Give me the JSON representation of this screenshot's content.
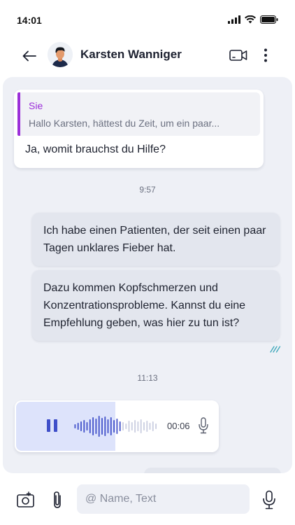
{
  "status_bar": {
    "time": "14:01",
    "icons": [
      "signal-icon",
      "wifi-icon",
      "battery-icon"
    ]
  },
  "header": {
    "contact_name": "Karsten Wanniger",
    "icons": [
      "back-arrow-icon",
      "avatar",
      "video-call-icon",
      "more-vertical-icon"
    ]
  },
  "chat": {
    "quoted_message": {
      "author": "Sie",
      "text": "Hallo Karsten, hättest du Zeit, um ein paar..."
    },
    "reply": "Ja, womit brauchst du Hilfe?",
    "time_1": "9:57",
    "outgoing": [
      "Ich habe einen Patienten, der seit einen paar Tagen unklares Fieber hat.",
      "Dazu kommen Kopfschmerzen und Konzentrationsprobleme. Kannst du eine Empfehlung geben, was hier zu tun ist?"
    ],
    "time_2": "11:13",
    "voice_message": {
      "duration": "00:06",
      "played_fraction": 0.5
    }
  },
  "input": {
    "placeholder": "@ Name, Text",
    "value": ""
  },
  "colors": {
    "accent_purple": "#9b2fd9",
    "player_blue": "#3f4fc9",
    "read_check": "#3aa6b9",
    "chat_background": "#eef0f6",
    "outgoing_bubble": "#e3e6ee"
  }
}
